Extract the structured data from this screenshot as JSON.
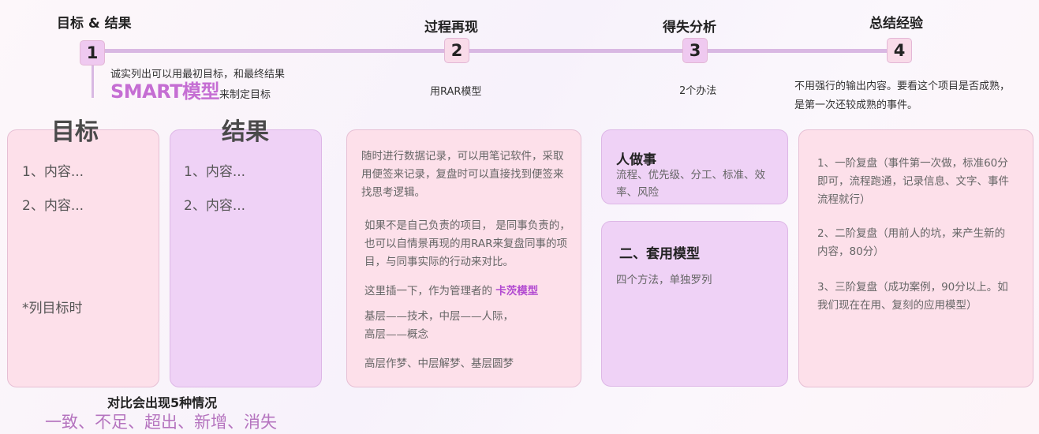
{
  "stages": [
    {
      "num": "1",
      "title": "目标 & 结果"
    },
    {
      "num": "2",
      "title": "过程再现"
    },
    {
      "num": "3",
      "title": "得失分析"
    },
    {
      "num": "4",
      "title": "总结经验"
    }
  ],
  "stage1": {
    "note1": "诚实列出可以用最初目标，和最终结果",
    "smart": "SMART模型",
    "note2": "来制定目标",
    "goal_card": {
      "title": "目标",
      "items": [
        "1、内容...",
        "2、内容..."
      ],
      "footnote": "*列目标时"
    },
    "result_card": {
      "title": "结果",
      "items": [
        "1、内容...",
        "2、内容..."
      ]
    },
    "summary_title": "对比会出现5种情况",
    "summary_items": "一致、不足、超出、新增、消失"
  },
  "stage2": {
    "note": "用RAR模型",
    "p1": "随时进行数据记录，可以用笔记软件，采取用便签来记录，复盘时可以直接找到便签来找思考逻辑。",
    "p2": "如果不是自己负责的项目， 是同事负责的，也可以自情景再现的用RAR来复盘同事的项目，与同事实际的行动来对比。",
    "p3_prefix": "这里插一下，作为管理者的",
    "p3_highlight": "卡茨模型",
    "p4_line1": "基层——技术，中层——人际，",
    "p4_line2": "高层——概念",
    "p5": "高层作梦、中层解梦、基层圆梦"
  },
  "stage3": {
    "note": "2个办法",
    "card1": {
      "title": "人做事",
      "text": "流程、优先级、分工、标准、效率、风险"
    },
    "card2": {
      "title": "二、套用模型",
      "text": "四个方法，单独罗列"
    }
  },
  "stage4": {
    "note": "不用强行的输出内容。要看这个项目是否成熟，是第一次还较成熟的事件。",
    "items": [
      "1、一阶复盘（事件第一次做，标准60分即可，流程跑通，记录信息、文字、事件流程就行）",
      "2、二阶复盘（用前人的坑，来产生新的内容，80分）",
      "3、三阶复盘（成功案例，90分以上。如我们现在在用、复刻的应用模型）"
    ]
  }
}
